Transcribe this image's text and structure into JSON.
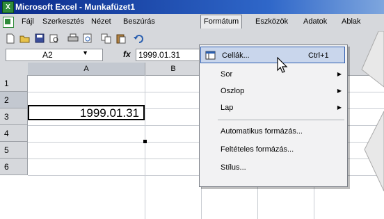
{
  "window": {
    "title": "Microsoft Excel - Munkafüzet1"
  },
  "menubar": {
    "items": [
      "Fájl",
      "Szerkesztés",
      "Nézet",
      "Beszúrás",
      "Formátum",
      "Eszközök",
      "Adatok",
      "Ablak"
    ],
    "open_menu": "Formátum"
  },
  "formula_bar": {
    "name_box": "A2",
    "fx_label": "fx",
    "content": "1999.01.31"
  },
  "grid": {
    "columns": [
      "A",
      "B"
    ],
    "rows": [
      "1",
      "2",
      "3",
      "4",
      "5",
      "6"
    ],
    "active_cell": {
      "ref": "A2",
      "value": "1999.01.31"
    }
  },
  "format_menu": {
    "items": [
      {
        "label": "Cellák...",
        "shortcut": "Ctrl+1",
        "submenu": false,
        "highlighted": true
      },
      {
        "label": "Sor",
        "shortcut": "",
        "submenu": true,
        "highlighted": false
      },
      {
        "label": "Oszlop",
        "shortcut": "",
        "submenu": true,
        "highlighted": false
      },
      {
        "label": "Lap",
        "shortcut": "",
        "submenu": true,
        "highlighted": false
      },
      {
        "label": "Automatikus formázás...",
        "shortcut": "",
        "submenu": false,
        "highlighted": false
      },
      {
        "label": "Feltételes formázás...",
        "shortcut": "",
        "submenu": false,
        "highlighted": false
      },
      {
        "label": "Stílus...",
        "shortcut": "",
        "submenu": false,
        "highlighted": false
      }
    ]
  },
  "icons": {
    "toolbar": [
      "new-icon",
      "open-icon",
      "save-icon",
      "print-preview-icon",
      "print-icon",
      "preview-icon",
      "copy-icon",
      "paste-icon",
      "undo-icon"
    ],
    "menu": "format-cells-icon",
    "submenu_arrow": "▶"
  },
  "colors": {
    "titlebar": "#0a2a8a",
    "highlight": "#c9d6ec",
    "excel_green": "#2e8b3a"
  }
}
